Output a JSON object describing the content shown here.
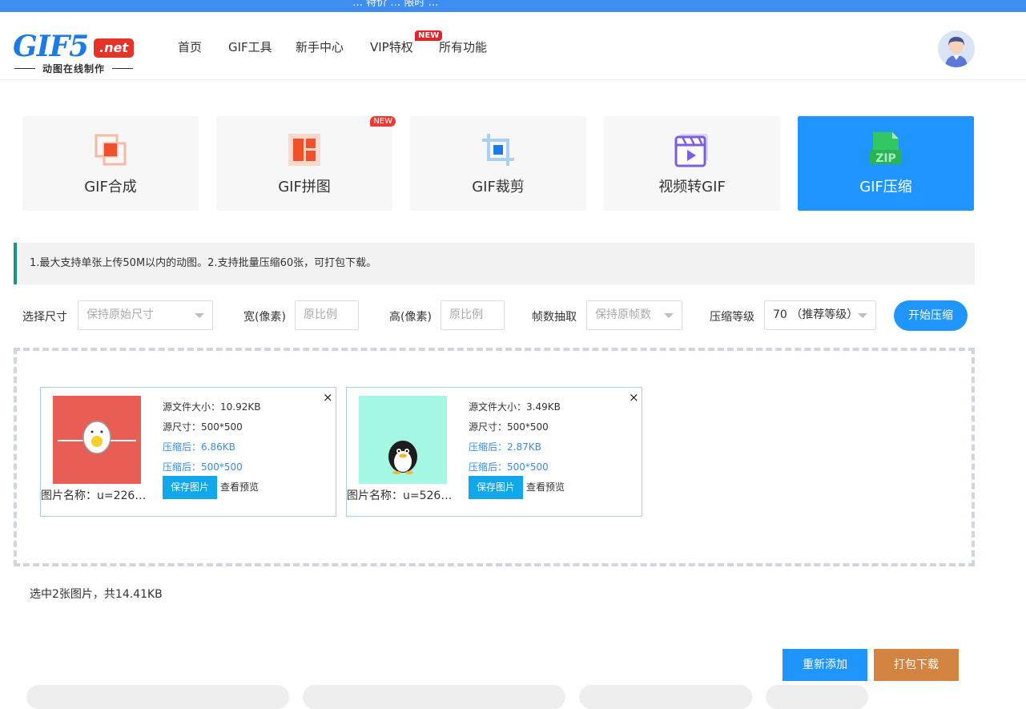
{
  "topbar": {
    "text": "… 特价 … 限时 …"
  },
  "logo": {
    "main": "GIF5",
    "net": ".net",
    "sub": "动图在线制作"
  },
  "nav": {
    "items": [
      "首页",
      "GIF工具",
      "新手中心",
      "VIP特权",
      "所有功能"
    ],
    "vip_badge": "NEW"
  },
  "tools": [
    {
      "label": "GIF合成",
      "icon": "merge-icon",
      "active": false
    },
    {
      "label": "GIF拼图",
      "icon": "collage-icon",
      "active": false,
      "badge": "NEW"
    },
    {
      "label": "GIF裁剪",
      "icon": "crop-icon",
      "active": false
    },
    {
      "label": "视频转GIF",
      "icon": "video-icon",
      "active": false
    },
    {
      "label": "GIF压缩",
      "icon": "zip-icon",
      "active": true
    }
  ],
  "notice": "1.最大支持单张上传50M以内的动图。2.支持批量压缩60张，可打包下载。",
  "options": {
    "size_label": "选择尺寸",
    "size_value": "保持原始尺寸",
    "width_label": "宽(像素)",
    "width_placeholder": "原比例",
    "height_label": "高(像素)",
    "height_placeholder": "原比例",
    "frames_label": "帧数抽取",
    "frames_value": "保持原帧数",
    "level_label": "压缩等级",
    "level_value": "70 （推荐等级）",
    "start_label": "开始压缩"
  },
  "files": [
    {
      "thumb_bg": "#e85e55",
      "src_size": "源文件大小：10.92KB",
      "src_dim": "源尺寸：500*500",
      "out_size": "压缩后：6.86KB",
      "out_dim": "压缩后：500*500",
      "name": "图片名称：u=226…",
      "save": "保存图片",
      "preview": "查看预览",
      "close": "×"
    },
    {
      "thumb_bg": "#a3f7e3",
      "src_size": "源文件大小：3.49KB",
      "src_dim": "源尺寸：500*500",
      "out_size": "压缩后：2.87KB",
      "out_dim": "压缩后：500*500",
      "name": "图片名称：u=526…",
      "save": "保存图片",
      "preview": "查看预览",
      "close": "×"
    }
  ],
  "summary": "选中2张图片，共14.41KB",
  "actions": {
    "readd": "重新添加",
    "download": "打包下载"
  },
  "colors": {
    "primary": "#1e95ff",
    "accent": "#d48441",
    "notice_bar": "#149b7d",
    "brand_red": "#e6332a"
  }
}
